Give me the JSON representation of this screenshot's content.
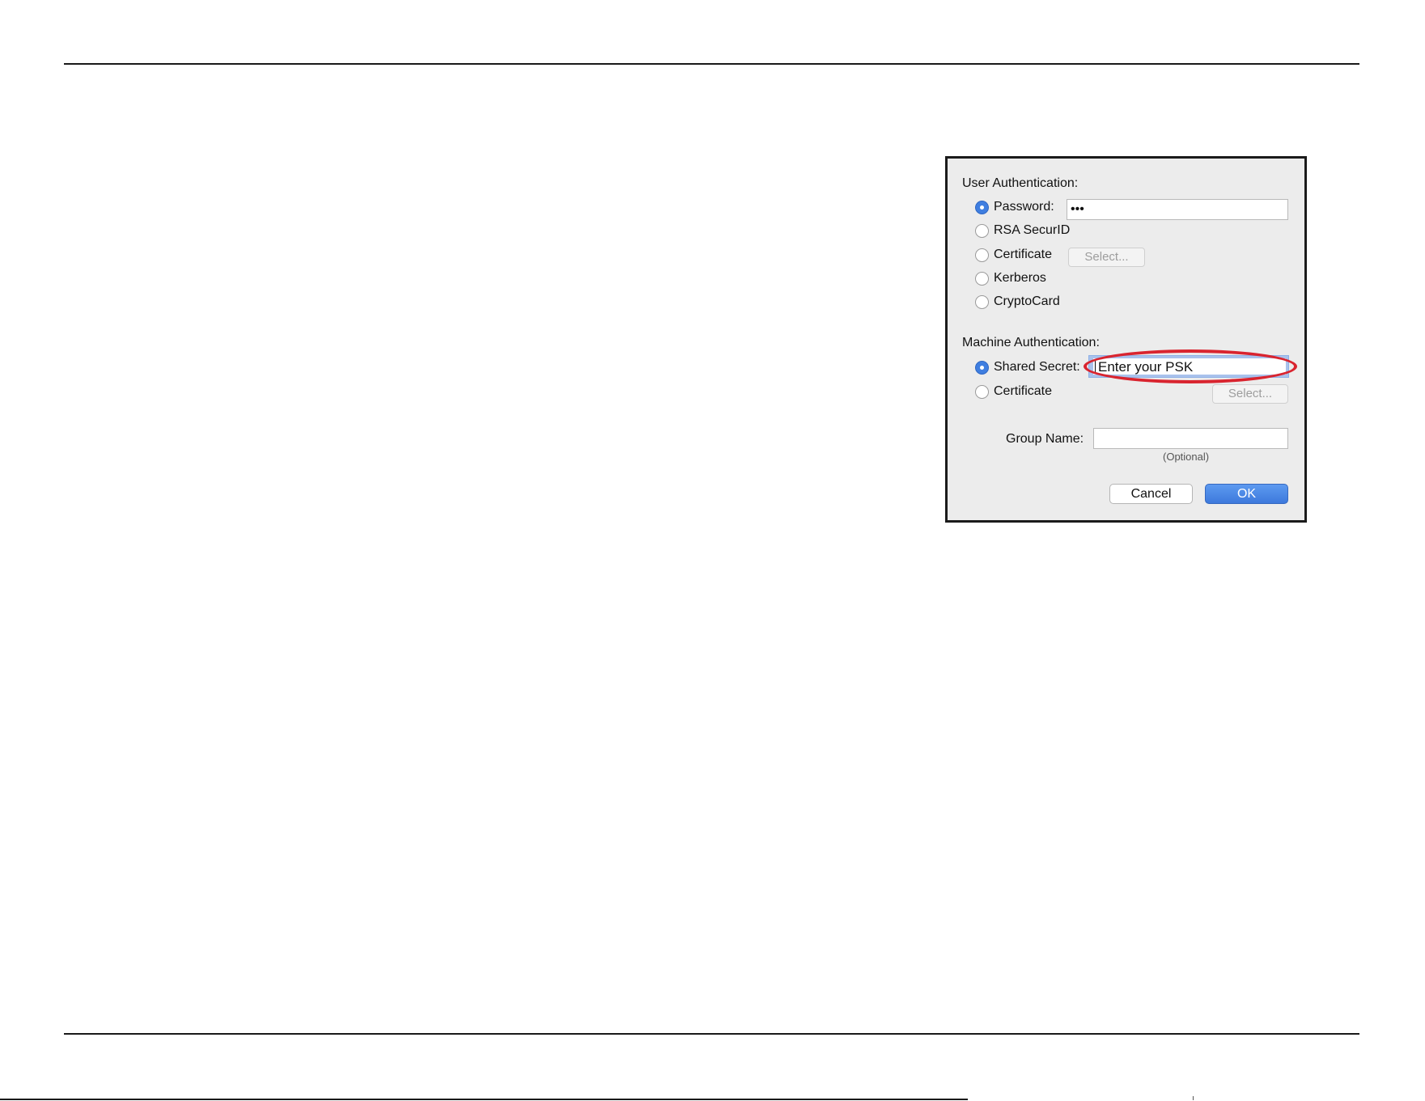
{
  "dialog": {
    "user_auth": {
      "heading": "User Authentication:",
      "options": [
        {
          "label": "Password:",
          "selected": true
        },
        {
          "label": "RSA SecurID",
          "selected": false
        },
        {
          "label": "Certificate",
          "selected": false
        },
        {
          "label": "Kerberos",
          "selected": false
        },
        {
          "label": "CryptoCard",
          "selected": false
        }
      ],
      "password_value": "•••",
      "select_label": "Select..."
    },
    "machine_auth": {
      "heading": "Machine Authentication:",
      "options": [
        {
          "label": "Shared Secret:",
          "selected": true
        },
        {
          "label": "Certificate",
          "selected": false
        }
      ],
      "shared_secret_value": "Enter your PSK",
      "select_label": "Select..."
    },
    "group": {
      "label": "Group Name:",
      "value": "",
      "hint": "(Optional)"
    },
    "buttons": {
      "cancel": "Cancel",
      "ok": "OK"
    }
  },
  "colors": {
    "accent": "#3f7ee0",
    "annotation": "#d9242f"
  }
}
